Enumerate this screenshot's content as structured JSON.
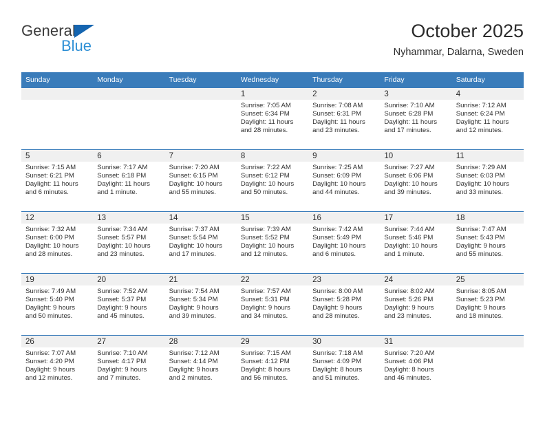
{
  "brand": {
    "name_part1": "General",
    "name_part2": "Blue",
    "triangle_color": "#1565b0",
    "blue_color": "#2d8fd5"
  },
  "header": {
    "month_title": "October 2025",
    "location": "Nyhammar, Dalarna, Sweden"
  },
  "theme": {
    "header_bg": "#3a7cba",
    "daynum_bg": "#f0f0f0",
    "row_border": "#3a7cba"
  },
  "weekday_headers": [
    "Sunday",
    "Monday",
    "Tuesday",
    "Wednesday",
    "Thursday",
    "Friday",
    "Saturday"
  ],
  "weeks": [
    [
      {
        "day": "",
        "sunrise": "",
        "sunset": "",
        "daylight_line1": "",
        "daylight_line2": ""
      },
      {
        "day": "",
        "sunrise": "",
        "sunset": "",
        "daylight_line1": "",
        "daylight_line2": ""
      },
      {
        "day": "",
        "sunrise": "",
        "sunset": "",
        "daylight_line1": "",
        "daylight_line2": ""
      },
      {
        "day": "1",
        "sunrise": "Sunrise: 7:05 AM",
        "sunset": "Sunset: 6:34 PM",
        "daylight_line1": "Daylight: 11 hours",
        "daylight_line2": "and 28 minutes."
      },
      {
        "day": "2",
        "sunrise": "Sunrise: 7:08 AM",
        "sunset": "Sunset: 6:31 PM",
        "daylight_line1": "Daylight: 11 hours",
        "daylight_line2": "and 23 minutes."
      },
      {
        "day": "3",
        "sunrise": "Sunrise: 7:10 AM",
        "sunset": "Sunset: 6:28 PM",
        "daylight_line1": "Daylight: 11 hours",
        "daylight_line2": "and 17 minutes."
      },
      {
        "day": "4",
        "sunrise": "Sunrise: 7:12 AM",
        "sunset": "Sunset: 6:24 PM",
        "daylight_line1": "Daylight: 11 hours",
        "daylight_line2": "and 12 minutes."
      }
    ],
    [
      {
        "day": "5",
        "sunrise": "Sunrise: 7:15 AM",
        "sunset": "Sunset: 6:21 PM",
        "daylight_line1": "Daylight: 11 hours",
        "daylight_line2": "and 6 minutes."
      },
      {
        "day": "6",
        "sunrise": "Sunrise: 7:17 AM",
        "sunset": "Sunset: 6:18 PM",
        "daylight_line1": "Daylight: 11 hours",
        "daylight_line2": "and 1 minute."
      },
      {
        "day": "7",
        "sunrise": "Sunrise: 7:20 AM",
        "sunset": "Sunset: 6:15 PM",
        "daylight_line1": "Daylight: 10 hours",
        "daylight_line2": "and 55 minutes."
      },
      {
        "day": "8",
        "sunrise": "Sunrise: 7:22 AM",
        "sunset": "Sunset: 6:12 PM",
        "daylight_line1": "Daylight: 10 hours",
        "daylight_line2": "and 50 minutes."
      },
      {
        "day": "9",
        "sunrise": "Sunrise: 7:25 AM",
        "sunset": "Sunset: 6:09 PM",
        "daylight_line1": "Daylight: 10 hours",
        "daylight_line2": "and 44 minutes."
      },
      {
        "day": "10",
        "sunrise": "Sunrise: 7:27 AM",
        "sunset": "Sunset: 6:06 PM",
        "daylight_line1": "Daylight: 10 hours",
        "daylight_line2": "and 39 minutes."
      },
      {
        "day": "11",
        "sunrise": "Sunrise: 7:29 AM",
        "sunset": "Sunset: 6:03 PM",
        "daylight_line1": "Daylight: 10 hours",
        "daylight_line2": "and 33 minutes."
      }
    ],
    [
      {
        "day": "12",
        "sunrise": "Sunrise: 7:32 AM",
        "sunset": "Sunset: 6:00 PM",
        "daylight_line1": "Daylight: 10 hours",
        "daylight_line2": "and 28 minutes."
      },
      {
        "day": "13",
        "sunrise": "Sunrise: 7:34 AM",
        "sunset": "Sunset: 5:57 PM",
        "daylight_line1": "Daylight: 10 hours",
        "daylight_line2": "and 23 minutes."
      },
      {
        "day": "14",
        "sunrise": "Sunrise: 7:37 AM",
        "sunset": "Sunset: 5:54 PM",
        "daylight_line1": "Daylight: 10 hours",
        "daylight_line2": "and 17 minutes."
      },
      {
        "day": "15",
        "sunrise": "Sunrise: 7:39 AM",
        "sunset": "Sunset: 5:52 PM",
        "daylight_line1": "Daylight: 10 hours",
        "daylight_line2": "and 12 minutes."
      },
      {
        "day": "16",
        "sunrise": "Sunrise: 7:42 AM",
        "sunset": "Sunset: 5:49 PM",
        "daylight_line1": "Daylight: 10 hours",
        "daylight_line2": "and 6 minutes."
      },
      {
        "day": "17",
        "sunrise": "Sunrise: 7:44 AM",
        "sunset": "Sunset: 5:46 PM",
        "daylight_line1": "Daylight: 10 hours",
        "daylight_line2": "and 1 minute."
      },
      {
        "day": "18",
        "sunrise": "Sunrise: 7:47 AM",
        "sunset": "Sunset: 5:43 PM",
        "daylight_line1": "Daylight: 9 hours",
        "daylight_line2": "and 55 minutes."
      }
    ],
    [
      {
        "day": "19",
        "sunrise": "Sunrise: 7:49 AM",
        "sunset": "Sunset: 5:40 PM",
        "daylight_line1": "Daylight: 9 hours",
        "daylight_line2": "and 50 minutes."
      },
      {
        "day": "20",
        "sunrise": "Sunrise: 7:52 AM",
        "sunset": "Sunset: 5:37 PM",
        "daylight_line1": "Daylight: 9 hours",
        "daylight_line2": "and 45 minutes."
      },
      {
        "day": "21",
        "sunrise": "Sunrise: 7:54 AM",
        "sunset": "Sunset: 5:34 PM",
        "daylight_line1": "Daylight: 9 hours",
        "daylight_line2": "and 39 minutes."
      },
      {
        "day": "22",
        "sunrise": "Sunrise: 7:57 AM",
        "sunset": "Sunset: 5:31 PM",
        "daylight_line1": "Daylight: 9 hours",
        "daylight_line2": "and 34 minutes."
      },
      {
        "day": "23",
        "sunrise": "Sunrise: 8:00 AM",
        "sunset": "Sunset: 5:28 PM",
        "daylight_line1": "Daylight: 9 hours",
        "daylight_line2": "and 28 minutes."
      },
      {
        "day": "24",
        "sunrise": "Sunrise: 8:02 AM",
        "sunset": "Sunset: 5:26 PM",
        "daylight_line1": "Daylight: 9 hours",
        "daylight_line2": "and 23 minutes."
      },
      {
        "day": "25",
        "sunrise": "Sunrise: 8:05 AM",
        "sunset": "Sunset: 5:23 PM",
        "daylight_line1": "Daylight: 9 hours",
        "daylight_line2": "and 18 minutes."
      }
    ],
    [
      {
        "day": "26",
        "sunrise": "Sunrise: 7:07 AM",
        "sunset": "Sunset: 4:20 PM",
        "daylight_line1": "Daylight: 9 hours",
        "daylight_line2": "and 12 minutes."
      },
      {
        "day": "27",
        "sunrise": "Sunrise: 7:10 AM",
        "sunset": "Sunset: 4:17 PM",
        "daylight_line1": "Daylight: 9 hours",
        "daylight_line2": "and 7 minutes."
      },
      {
        "day": "28",
        "sunrise": "Sunrise: 7:12 AM",
        "sunset": "Sunset: 4:14 PM",
        "daylight_line1": "Daylight: 9 hours",
        "daylight_line2": "and 2 minutes."
      },
      {
        "day": "29",
        "sunrise": "Sunrise: 7:15 AM",
        "sunset": "Sunset: 4:12 PM",
        "daylight_line1": "Daylight: 8 hours",
        "daylight_line2": "and 56 minutes."
      },
      {
        "day": "30",
        "sunrise": "Sunrise: 7:18 AM",
        "sunset": "Sunset: 4:09 PM",
        "daylight_line1": "Daylight: 8 hours",
        "daylight_line2": "and 51 minutes."
      },
      {
        "day": "31",
        "sunrise": "Sunrise: 7:20 AM",
        "sunset": "Sunset: 4:06 PM",
        "daylight_line1": "Daylight: 8 hours",
        "daylight_line2": "and 46 minutes."
      },
      {
        "day": "",
        "sunrise": "",
        "sunset": "",
        "daylight_line1": "",
        "daylight_line2": ""
      }
    ]
  ]
}
